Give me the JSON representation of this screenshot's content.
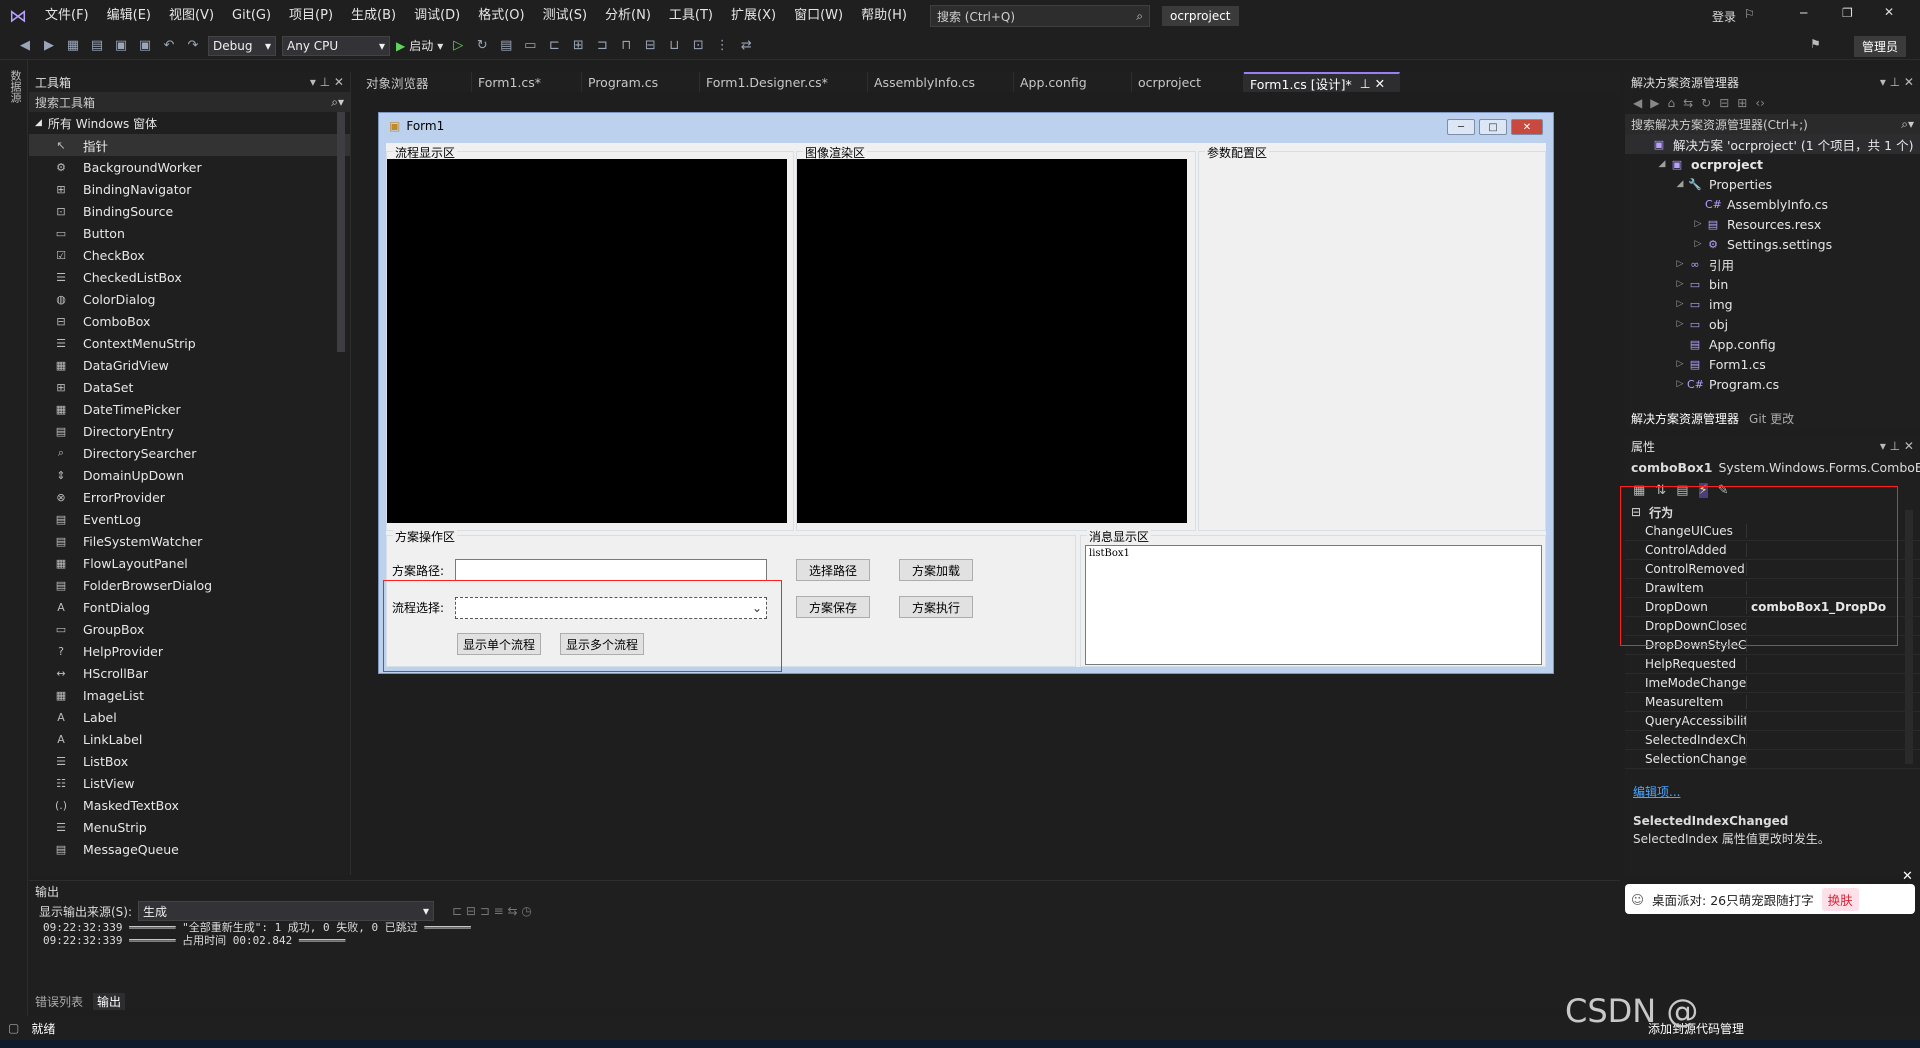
{
  "menubar": {
    "items": [
      "文件(F)",
      "编辑(E)",
      "视图(V)",
      "Git(G)",
      "项目(P)",
      "生成(B)",
      "调试(D)",
      "格式(O)",
      "测试(S)",
      "分析(N)",
      "工具(T)",
      "扩展(X)",
      "窗口(W)",
      "帮助(H)"
    ],
    "search_placeholder": "搜索 (Ctrl+Q)",
    "project_name": "ocrproject",
    "login": "登录",
    "admin": "管理员"
  },
  "toolbar": {
    "config": "Debug",
    "platform": "Any CPU",
    "start": "启动"
  },
  "leftstrip": {
    "label": "数据源"
  },
  "toolbox": {
    "title": "工具箱",
    "search": "搜索工具箱",
    "category": "所有 Windows 窗体",
    "items": [
      "指针",
      "BackgroundWorker",
      "BindingNavigator",
      "BindingSource",
      "Button",
      "CheckBox",
      "CheckedListBox",
      "ColorDialog",
      "ComboBox",
      "ContextMenuStrip",
      "DataGridView",
      "DataSet",
      "DateTimePicker",
      "DirectoryEntry",
      "DirectorySearcher",
      "DomainUpDown",
      "ErrorProvider",
      "EventLog",
      "FileSystemWatcher",
      "FlowLayoutPanel",
      "FolderBrowserDialog",
      "FontDialog",
      "GroupBox",
      "HelpProvider",
      "HScrollBar",
      "ImageList",
      "Label",
      "LinkLabel",
      "ListBox",
      "ListView",
      "MaskedTextBox",
      "MenuStrip",
      "MessageQueue"
    ]
  },
  "tabs": [
    "对象浏览器",
    "Form1.cs*",
    "Program.cs",
    "Form1.Designer.cs*",
    "AssemblyInfo.cs",
    "App.config",
    "ocrproject",
    "Form1.cs [设计]*"
  ],
  "form": {
    "title": "Form1",
    "group_flow": "流程显示区",
    "group_image": "图像渲染区",
    "group_params": "参数配置区",
    "group_ops": "方案操作区",
    "group_msg": "消息显示区",
    "label_path": "方案路径:",
    "label_flow": "流程选择:",
    "btn_select_path": "选择路径",
    "btn_load": "方案加载",
    "btn_save": "方案保存",
    "btn_exec": "方案执行",
    "btn_single": "显示单个流程",
    "btn_multi": "显示多个流程",
    "listbox": "listBox1"
  },
  "solution": {
    "title": "解决方案资源管理器",
    "search": "搜索解决方案资源管理器(Ctrl+;)",
    "items": [
      {
        "label": "解决方案 'ocrproject' (1 个项目，共 1 个)",
        "indent": 0,
        "bold": false
      },
      {
        "label": "ocrproject",
        "indent": 1,
        "bold": true
      },
      {
        "label": "Properties",
        "indent": 2,
        "bold": false
      },
      {
        "label": "AssemblyInfo.cs",
        "indent": 3,
        "bold": false
      },
      {
        "label": "Resources.resx",
        "indent": 3,
        "bold": false
      },
      {
        "label": "Settings.settings",
        "indent": 3,
        "bold": false
      },
      {
        "label": "引用",
        "indent": 2,
        "bold": false
      },
      {
        "label": "bin",
        "indent": 2,
        "bold": false
      },
      {
        "label": "img",
        "indent": 2,
        "bold": false
      },
      {
        "label": "obj",
        "indent": 2,
        "bold": false
      },
      {
        "label": "App.config",
        "indent": 2,
        "bold": false
      },
      {
        "label": "Form1.cs",
        "indent": 2,
        "bold": false
      },
      {
        "label": "Program.cs",
        "indent": 2,
        "bold": false
      }
    ],
    "tab1": "解决方案资源管理器",
    "tab2": "Git 更改"
  },
  "properties": {
    "title": "属性",
    "object": "comboBox1",
    "object_type": "System.Windows.Forms.ComboB",
    "category": "行为",
    "rows": [
      {
        "name": "ChangeUICues",
        "value": ""
      },
      {
        "name": "ControlAdded",
        "value": ""
      },
      {
        "name": "ControlRemoved",
        "value": ""
      },
      {
        "name": "DrawItem",
        "value": ""
      },
      {
        "name": "DropDown",
        "value": "comboBox1_DropDo"
      },
      {
        "name": "DropDownClosed",
        "value": ""
      },
      {
        "name": "DropDownStyleChan",
        "value": ""
      },
      {
        "name": "HelpRequested",
        "value": ""
      },
      {
        "name": "ImeModeChanged",
        "value": ""
      },
      {
        "name": "MeasureItem",
        "value": ""
      },
      {
        "name": "QueryAccessibilityHe",
        "value": ""
      },
      {
        "name": "SelectedIndexChang",
        "value": ""
      },
      {
        "name": "SelectionChangeCon",
        "value": ""
      }
    ],
    "edit_link": "编辑项...",
    "desc_title": "SelectedIndexChanged",
    "desc_text": "SelectedIndex 属性值更改时发生。"
  },
  "output": {
    "title": "输出",
    "source_label": "显示输出来源(S):",
    "source_value": "生成",
    "lines": [
      "09:22:32:339     ═══════  \"全部重新生成\": 1 成功, 0 失败, 0 已跳过 ═══════",
      "09:22:32:339     ═══════ 占用时间 00:02.842 ═══════"
    ],
    "tab1": "错误列表",
    "tab2": "输出"
  },
  "notification": {
    "text": "桌面派对: 26只萌宠跟随打字",
    "button": "换肤"
  },
  "status": {
    "ready": "就绪",
    "scm": "添加到源代码管理",
    "watermark": "CSDN @"
  }
}
